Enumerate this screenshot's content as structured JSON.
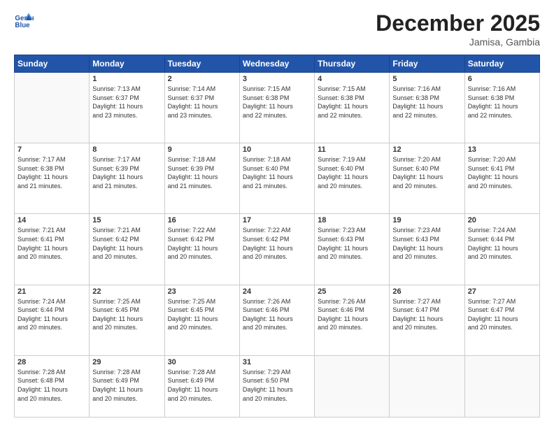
{
  "logo": {
    "line1": "General",
    "line2": "Blue"
  },
  "title": "December 2025",
  "subtitle": "Jamisa, Gambia",
  "headers": [
    "Sunday",
    "Monday",
    "Tuesday",
    "Wednesday",
    "Thursday",
    "Friday",
    "Saturday"
  ],
  "weeks": [
    [
      {
        "day": "",
        "info": ""
      },
      {
        "day": "1",
        "info": "Sunrise: 7:13 AM\nSunset: 6:37 PM\nDaylight: 11 hours\nand 23 minutes."
      },
      {
        "day": "2",
        "info": "Sunrise: 7:14 AM\nSunset: 6:37 PM\nDaylight: 11 hours\nand 23 minutes."
      },
      {
        "day": "3",
        "info": "Sunrise: 7:15 AM\nSunset: 6:38 PM\nDaylight: 11 hours\nand 22 minutes."
      },
      {
        "day": "4",
        "info": "Sunrise: 7:15 AM\nSunset: 6:38 PM\nDaylight: 11 hours\nand 22 minutes."
      },
      {
        "day": "5",
        "info": "Sunrise: 7:16 AM\nSunset: 6:38 PM\nDaylight: 11 hours\nand 22 minutes."
      },
      {
        "day": "6",
        "info": "Sunrise: 7:16 AM\nSunset: 6:38 PM\nDaylight: 11 hours\nand 22 minutes."
      }
    ],
    [
      {
        "day": "7",
        "info": "Sunrise: 7:17 AM\nSunset: 6:38 PM\nDaylight: 11 hours\nand 21 minutes."
      },
      {
        "day": "8",
        "info": "Sunrise: 7:17 AM\nSunset: 6:39 PM\nDaylight: 11 hours\nand 21 minutes."
      },
      {
        "day": "9",
        "info": "Sunrise: 7:18 AM\nSunset: 6:39 PM\nDaylight: 11 hours\nand 21 minutes."
      },
      {
        "day": "10",
        "info": "Sunrise: 7:18 AM\nSunset: 6:40 PM\nDaylight: 11 hours\nand 21 minutes."
      },
      {
        "day": "11",
        "info": "Sunrise: 7:19 AM\nSunset: 6:40 PM\nDaylight: 11 hours\nand 20 minutes."
      },
      {
        "day": "12",
        "info": "Sunrise: 7:20 AM\nSunset: 6:40 PM\nDaylight: 11 hours\nand 20 minutes."
      },
      {
        "day": "13",
        "info": "Sunrise: 7:20 AM\nSunset: 6:41 PM\nDaylight: 11 hours\nand 20 minutes."
      }
    ],
    [
      {
        "day": "14",
        "info": "Sunrise: 7:21 AM\nSunset: 6:41 PM\nDaylight: 11 hours\nand 20 minutes."
      },
      {
        "day": "15",
        "info": "Sunrise: 7:21 AM\nSunset: 6:42 PM\nDaylight: 11 hours\nand 20 minutes."
      },
      {
        "day": "16",
        "info": "Sunrise: 7:22 AM\nSunset: 6:42 PM\nDaylight: 11 hours\nand 20 minutes."
      },
      {
        "day": "17",
        "info": "Sunrise: 7:22 AM\nSunset: 6:42 PM\nDaylight: 11 hours\nand 20 minutes."
      },
      {
        "day": "18",
        "info": "Sunrise: 7:23 AM\nSunset: 6:43 PM\nDaylight: 11 hours\nand 20 minutes."
      },
      {
        "day": "19",
        "info": "Sunrise: 7:23 AM\nSunset: 6:43 PM\nDaylight: 11 hours\nand 20 minutes."
      },
      {
        "day": "20",
        "info": "Sunrise: 7:24 AM\nSunset: 6:44 PM\nDaylight: 11 hours\nand 20 minutes."
      }
    ],
    [
      {
        "day": "21",
        "info": "Sunrise: 7:24 AM\nSunset: 6:44 PM\nDaylight: 11 hours\nand 20 minutes."
      },
      {
        "day": "22",
        "info": "Sunrise: 7:25 AM\nSunset: 6:45 PM\nDaylight: 11 hours\nand 20 minutes."
      },
      {
        "day": "23",
        "info": "Sunrise: 7:25 AM\nSunset: 6:45 PM\nDaylight: 11 hours\nand 20 minutes."
      },
      {
        "day": "24",
        "info": "Sunrise: 7:26 AM\nSunset: 6:46 PM\nDaylight: 11 hours\nand 20 minutes."
      },
      {
        "day": "25",
        "info": "Sunrise: 7:26 AM\nSunset: 6:46 PM\nDaylight: 11 hours\nand 20 minutes."
      },
      {
        "day": "26",
        "info": "Sunrise: 7:27 AM\nSunset: 6:47 PM\nDaylight: 11 hours\nand 20 minutes."
      },
      {
        "day": "27",
        "info": "Sunrise: 7:27 AM\nSunset: 6:47 PM\nDaylight: 11 hours\nand 20 minutes."
      }
    ],
    [
      {
        "day": "28",
        "info": "Sunrise: 7:28 AM\nSunset: 6:48 PM\nDaylight: 11 hours\nand 20 minutes."
      },
      {
        "day": "29",
        "info": "Sunrise: 7:28 AM\nSunset: 6:49 PM\nDaylight: 11 hours\nand 20 minutes."
      },
      {
        "day": "30",
        "info": "Sunrise: 7:28 AM\nSunset: 6:49 PM\nDaylight: 11 hours\nand 20 minutes."
      },
      {
        "day": "31",
        "info": "Sunrise: 7:29 AM\nSunset: 6:50 PM\nDaylight: 11 hours\nand 20 minutes."
      },
      {
        "day": "",
        "info": ""
      },
      {
        "day": "",
        "info": ""
      },
      {
        "day": "",
        "info": ""
      }
    ]
  ]
}
